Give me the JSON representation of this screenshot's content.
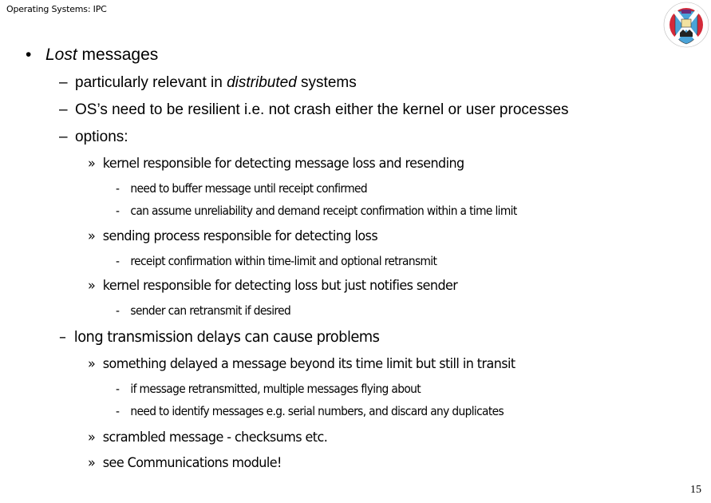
{
  "header": {
    "title": "Operating Systems: IPC"
  },
  "logo": {
    "name": "university-crest",
    "colors": {
      "ring": "#d42a3a",
      "saltire_bg": "#4aa3d8",
      "saltire": "#ffffff",
      "top": "#6a2b7a"
    }
  },
  "page_number": "15",
  "markers": {
    "bullet": "•",
    "dash": "–",
    "raquo": "»",
    "hyphen": "-"
  },
  "slide": {
    "l1": {
      "em": "Lost",
      "rest": " messages"
    },
    "l2a": {
      "pre": "particularly relevant in ",
      "em": "distributed",
      "post": " systems"
    },
    "l2b": "OS’s need to be resilient i.e. not crash either the kernel or user processes",
    "l2c": "options:",
    "l3a": "kernel responsible for detecting message loss and resending",
    "l4a": "need to buffer message until receipt confirmed",
    "l4b": "can assume unreliability and demand receipt confirmation within a time limit",
    "l3b": "sending process responsible for detecting loss",
    "l4c": "receipt confirmation within time-limit and optional retransmit",
    "l3c": "kernel responsible for detecting loss but just notifies sender",
    "l4d": "sender can retransmit if desired",
    "l2d": "long transmission delays can cause problems",
    "l3d": "something delayed a message beyond its time limit but still in transit",
    "l4e": "if message retransmitted, multiple messages flying about",
    "l4f": "need to identify messages e.g. serial numbers, and discard any duplicates",
    "l3e": "scrambled message - checksums etc.",
    "l3f": "see Communications module!"
  }
}
